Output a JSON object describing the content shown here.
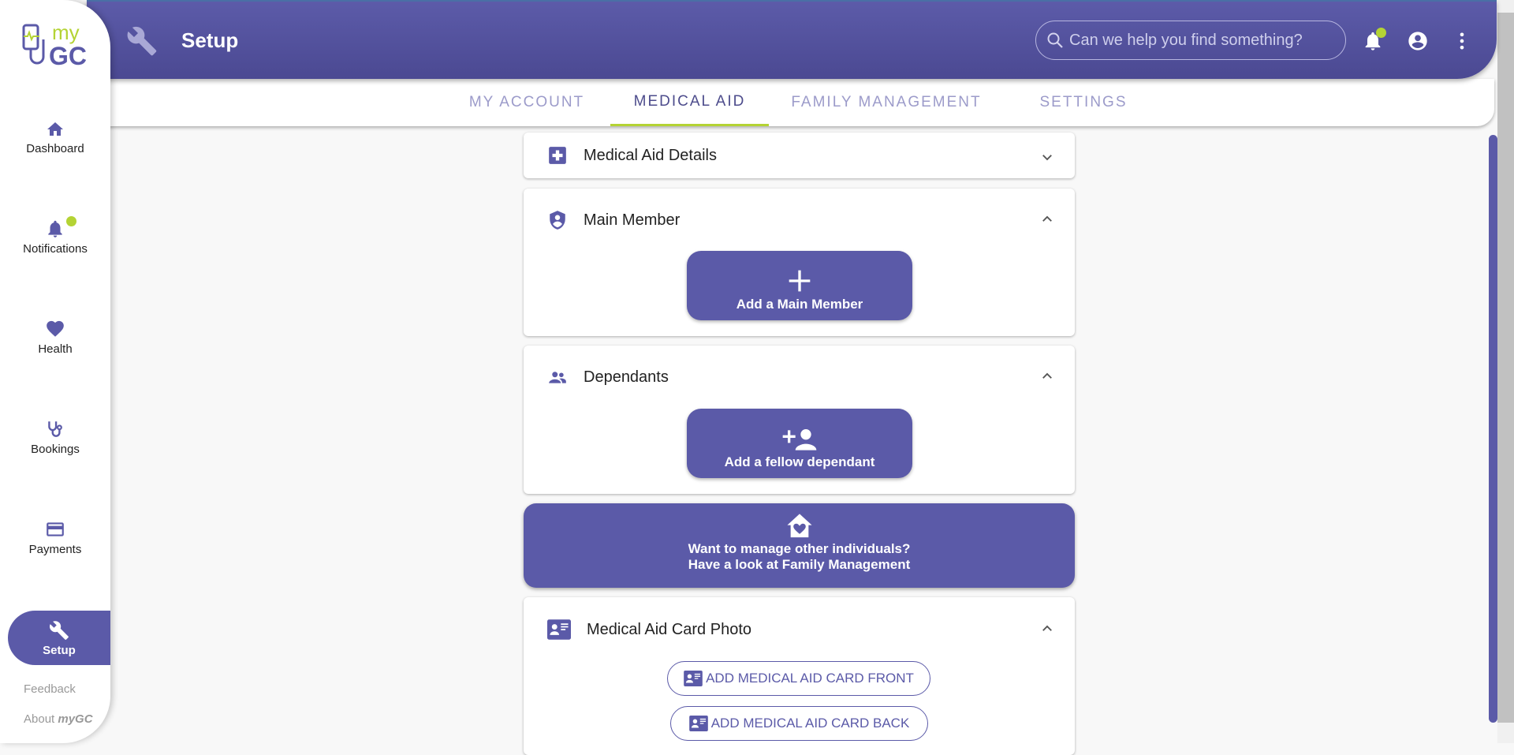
{
  "app": {
    "logo_text": "myGC"
  },
  "header": {
    "title": "Setup",
    "search_placeholder": "Can we help you find something?"
  },
  "tabs": [
    {
      "label": "MY ACCOUNT"
    },
    {
      "label": "MEDICAL AID"
    },
    {
      "label": "FAMILY MANAGEMENT"
    },
    {
      "label": "SETTINGS"
    }
  ],
  "sidebar": {
    "items": [
      {
        "label": "Dashboard"
      },
      {
        "label": "Notifications"
      },
      {
        "label": "Health"
      },
      {
        "label": "Bookings"
      },
      {
        "label": "Payments"
      },
      {
        "label": "Setup"
      }
    ],
    "feedback": "Feedback",
    "about": "About",
    "about_brand": "myGC"
  },
  "sections": {
    "details": {
      "title": "Medical Aid Details"
    },
    "main_member": {
      "title": "Main Member",
      "button": "Add a Main Member"
    },
    "dependants": {
      "title": "Dependants",
      "button": "Add a fellow dependant"
    },
    "banner": {
      "line1": "Want to manage other individuals?",
      "line2": "Have a look at Family Management"
    },
    "card_photo": {
      "title": "Medical Aid Card Photo",
      "front": "ADD MEDICAL AID CARD FRONT",
      "back": "ADD MEDICAL AID CARD BACK"
    }
  },
  "colors": {
    "primary": "#5b5aa8",
    "accent": "#b4d334"
  }
}
